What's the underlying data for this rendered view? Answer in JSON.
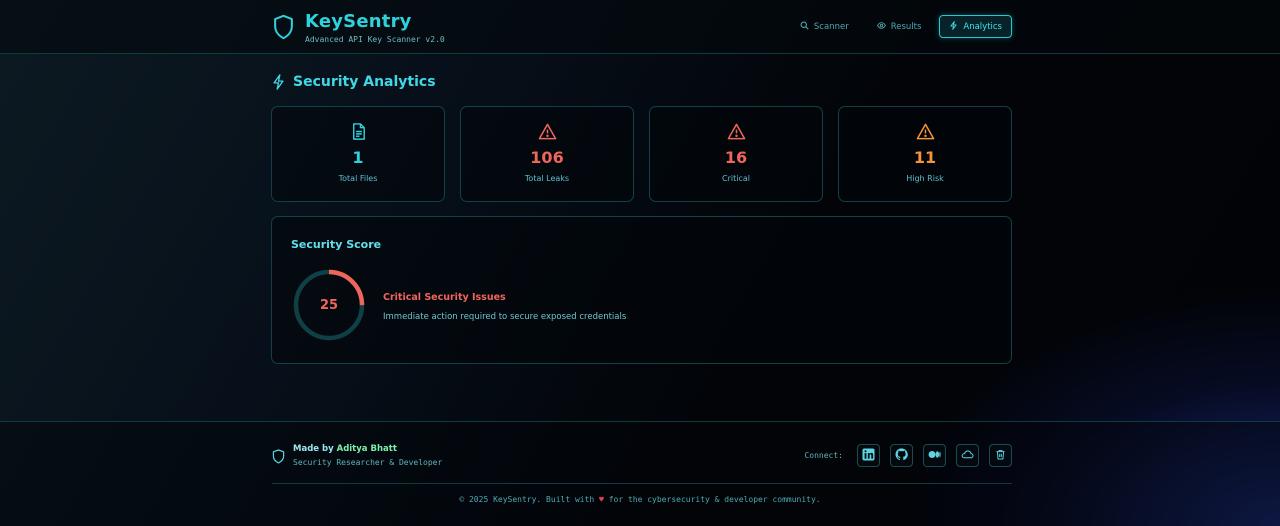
{
  "header": {
    "title": "KeySentry",
    "subtitle": "Advanced API Key Scanner v2.0",
    "nav": [
      {
        "label": "Scanner",
        "icon": "search-icon"
      },
      {
        "label": "Results",
        "icon": "eye-icon"
      },
      {
        "label": "Analytics",
        "icon": "lightning-icon",
        "active": true
      }
    ]
  },
  "main": {
    "section_title": "Security Analytics",
    "stats": [
      {
        "value": "1",
        "label": "Total Files",
        "icon": "file-icon",
        "color": "#2ed1dc"
      },
      {
        "value": "106",
        "label": "Total Leaks",
        "icon": "alert-triangle-icon",
        "color": "#f0655b"
      },
      {
        "value": "16",
        "label": "Critical",
        "icon": "alert-triangle-icon",
        "color": "#f0655b"
      },
      {
        "value": "11",
        "label": "High Risk",
        "icon": "alert-triangle-icon",
        "color": "#f5923b"
      }
    ],
    "score": {
      "title": "Security Score",
      "value": "25",
      "fraction": 0.25,
      "status_title": "Critical Security Issues",
      "status_desc": "Immediate action required to secure exposed credentials",
      "color": "#f0655b"
    }
  },
  "footer": {
    "made_by_prefix": "Made by",
    "author": "Aditya Bhatt",
    "role": "Security Researcher & Developer",
    "connect_label": "Connect:",
    "socials": [
      "linkedin-icon",
      "github-icon",
      "medium-icon",
      "cloud-icon",
      "trash-icon"
    ],
    "copyright_pre": "© 2025 KeySentry. Built with",
    "heart": "♥",
    "copyright_post": "for the cybersecurity & developer community."
  },
  "colors": {
    "accent": "#2ed1dc",
    "danger": "#f0655b",
    "warning": "#f5923b"
  }
}
